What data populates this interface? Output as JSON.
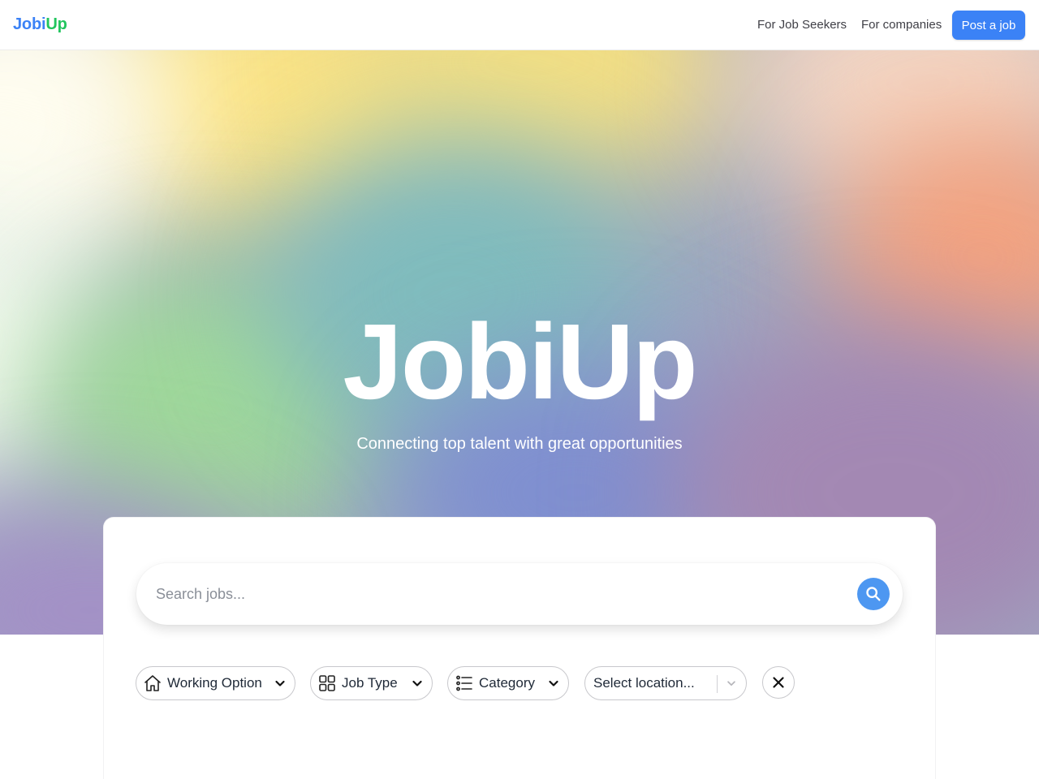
{
  "header": {
    "logo_part1": "Jobi",
    "logo_part2": "Up",
    "nav": {
      "job_seekers": "For Job Seekers",
      "companies": "For companies"
    },
    "post_job_label": "Post a job"
  },
  "hero": {
    "title": "JobiUp",
    "subtitle": "Connecting top talent with great opportunities"
  },
  "search": {
    "placeholder": "Search jobs...",
    "icon": "search-icon"
  },
  "filters": {
    "working_option": {
      "label": "Working Option",
      "icon": "home-icon"
    },
    "job_type": {
      "label": "Job Type",
      "icon": "grid-icon"
    },
    "category": {
      "label": "Category",
      "icon": "list-icon"
    },
    "location": {
      "placeholder": "Select location..."
    },
    "clear_icon": "close-icon"
  },
  "colors": {
    "brand_blue": "#3b82f6",
    "brand_green": "#22c55e",
    "search_button": "#4d97f1"
  }
}
